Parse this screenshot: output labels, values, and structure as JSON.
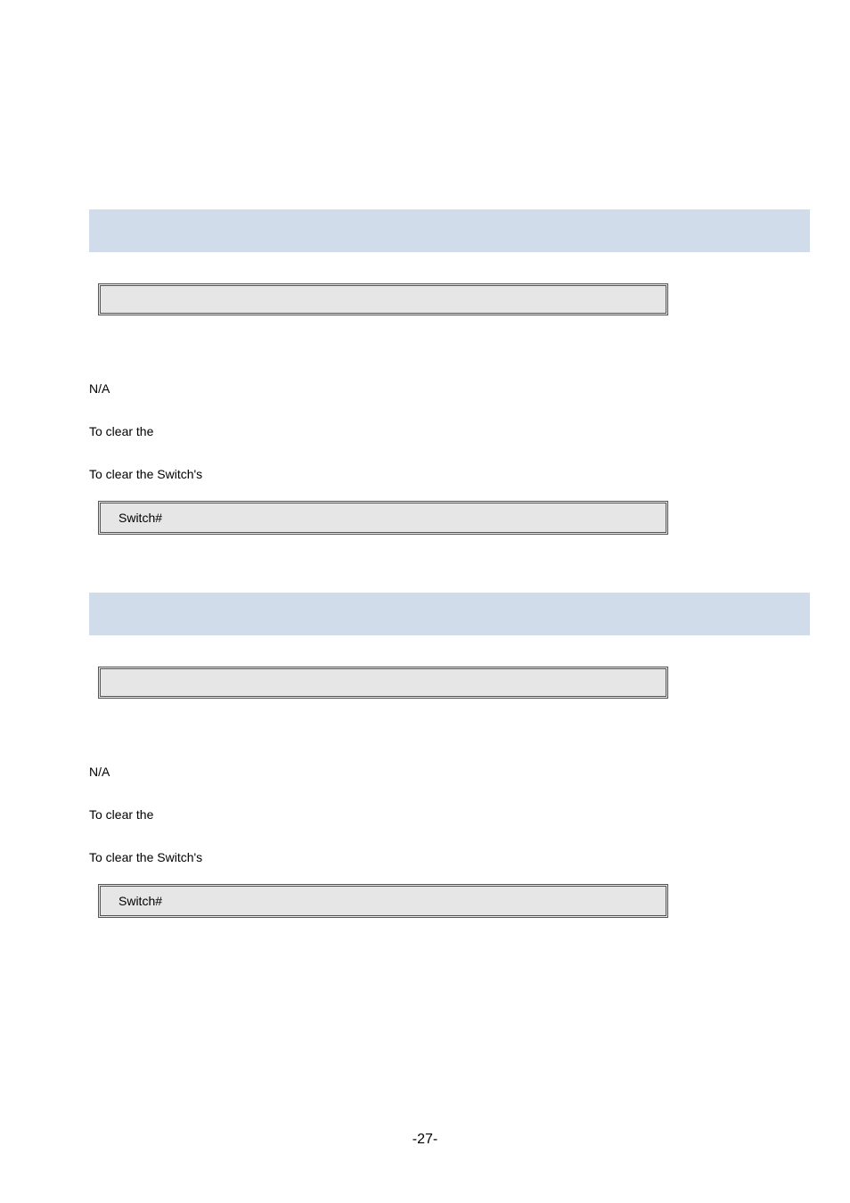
{
  "sections": [
    {
      "syntax": "",
      "parameters": "N/A",
      "default": "To clear the",
      "usage": "To clear the Switch's",
      "example_prompt": "Switch#"
    },
    {
      "syntax": "",
      "parameters": "N/A",
      "default": "To clear the",
      "usage": "To clear the Switch's",
      "example_prompt": "Switch#"
    }
  ],
  "page_number": "-27-"
}
